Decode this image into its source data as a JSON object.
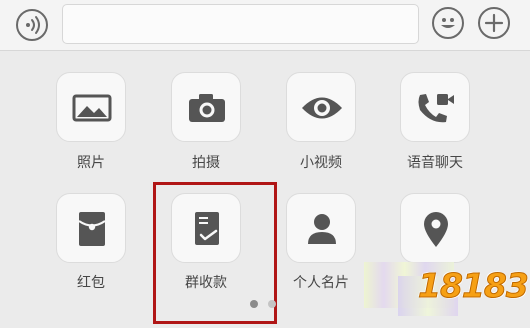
{
  "input_bar": {
    "message_value": "",
    "icons": {
      "voice": "voice-icon",
      "emoji": "emoji-icon",
      "more": "plus-icon"
    }
  },
  "panel": {
    "items": [
      {
        "label": "照片",
        "icon": "image-icon"
      },
      {
        "label": "拍摄",
        "icon": "camera-icon"
      },
      {
        "label": "小视频",
        "icon": "eye-icon"
      },
      {
        "label": "语音聊天",
        "icon": "video-call-icon"
      },
      {
        "label": "红包",
        "icon": "red-packet-icon"
      },
      {
        "label": "群收款",
        "icon": "group-collect-icon"
      },
      {
        "label": "个人名片",
        "icon": "contact-card-icon"
      },
      {
        "label": "",
        "icon": "location-icon"
      }
    ],
    "highlighted_item": "群收款",
    "pagination": {
      "pages": 2,
      "current": 1
    }
  },
  "watermark": {
    "text": "18183"
  },
  "colors": {
    "highlight_border": "#b01616",
    "icon_gray": "#555555",
    "watermark_orange": "#f6a015"
  }
}
